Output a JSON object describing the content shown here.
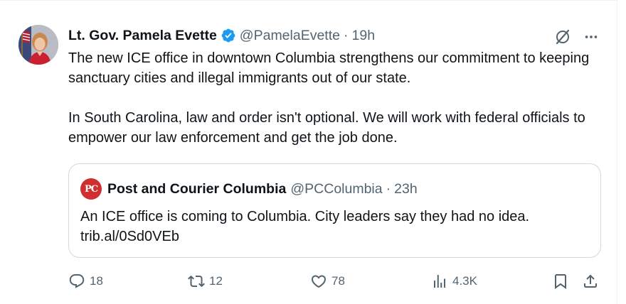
{
  "tweet": {
    "author": {
      "display_name": "Lt. Gov. Pamela Evette",
      "handle": "@PamelaEvette",
      "verified": true
    },
    "separator": "·",
    "time": "19h",
    "paragraphs": [
      "The new ICE office in downtown Columbia strengthens our commitment to keeping sanctuary cities and illegal immigrants out of our state.",
      "In South Carolina, law and order isn't optional. We will work with federal officials to empower our law enforcement and get the job done."
    ]
  },
  "quoted": {
    "logo_text": "PC",
    "display_name": "Post and Courier Columbia",
    "handle": "@PCColumbia",
    "separator": "·",
    "time": "23h",
    "text_line1": "An ICE office is coming to Columbia. City leaders say they had no idea.",
    "text_line2": "trib.al/0Sd0VEb"
  },
  "actions": {
    "replies": "18",
    "reposts": "12",
    "likes": "78",
    "views": "4.3K"
  },
  "colors": {
    "text": "#0f1419",
    "secondary": "#536471",
    "verified": "#1d9bf0",
    "border": "#cfd9de",
    "quote_logo": "#d12f2f"
  },
  "icons": {
    "verified": "verified-badge-icon",
    "grok": "grok-icon",
    "more": "more-icon",
    "reply": "reply-icon",
    "retweet": "retweet-icon",
    "like": "heart-icon",
    "views": "views-icon",
    "bookmark": "bookmark-icon",
    "share": "share-icon"
  }
}
